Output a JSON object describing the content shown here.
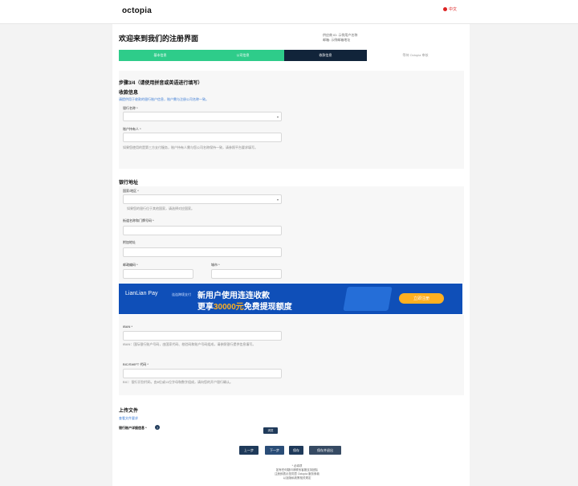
{
  "header": {
    "logo": "octopia",
    "lang": "中文"
  },
  "page": {
    "title": "欢迎来到我们的注册界面",
    "account_line1": "供应商 ID: 示例用户名称",
    "account_line2": "邮箱: 示例邮箱地址"
  },
  "steps": [
    "基本信息",
    "公司信息",
    "收款信息",
    "等待 Octopia 审核"
  ],
  "section1": {
    "title": "步骤3/4（请使用拼音或英语进行填写）",
    "subtitle": "收款信息",
    "note": "请提供用于收款的银行账户信息，账户需与注册公司名称一致。",
    "bank_name_label": "银行名称 *",
    "holder_label": "账户持有人 *",
    "hint": "如果您使用的是第三方支付服务，账户持有人需与您公司名称保持一致，请参照平台要求填写。"
  },
  "section2": {
    "title": "银行地址",
    "country_label": "国家/地区 *",
    "country_hint": "如果您的银行位于其他国家，请选择对应国家。",
    "street_label": "街道名称和门牌号码 *",
    "extra_label": "附加地址",
    "postal_label": "邮政编码 *",
    "city_label": "城市 *"
  },
  "banner": {
    "brand": "LianLian Pay",
    "tag": "连连跨境支付",
    "line1": "新用户使用连连收款",
    "line2_pre": "更享",
    "line2_amt": "30000元",
    "line2_post": "免费提现额度",
    "cta": "立即注册"
  },
  "section3": {
    "iban_label": "IBAN *",
    "iban_hint": "IBAN：国际银行账户号码，由国家代码、校验码和账户号码组成，请参照银行提供信息填写。",
    "bic_label": "BIC/SWIFT 代码 *",
    "bic_hint": "BIC：银行识别代码，由8位或11位字母和数字组成，请向您的开户银行确认。"
  },
  "upload": {
    "title": "上传文件",
    "link": "查看文件要求",
    "label": "银行账户详细信息 *",
    "browse": "浏览"
  },
  "buttons": {
    "prev": "上一步",
    "next": "下一步",
    "save": "保存",
    "save_exit": "保存并退出"
  },
  "footer": {
    "l1": "* 必填项",
    "l2": "如有任何疑问请联系客服支持团队",
    "l3": "注册即表示您同意 Octopia 服务条款",
    "l4": "以及隐私政策相关规定"
  }
}
